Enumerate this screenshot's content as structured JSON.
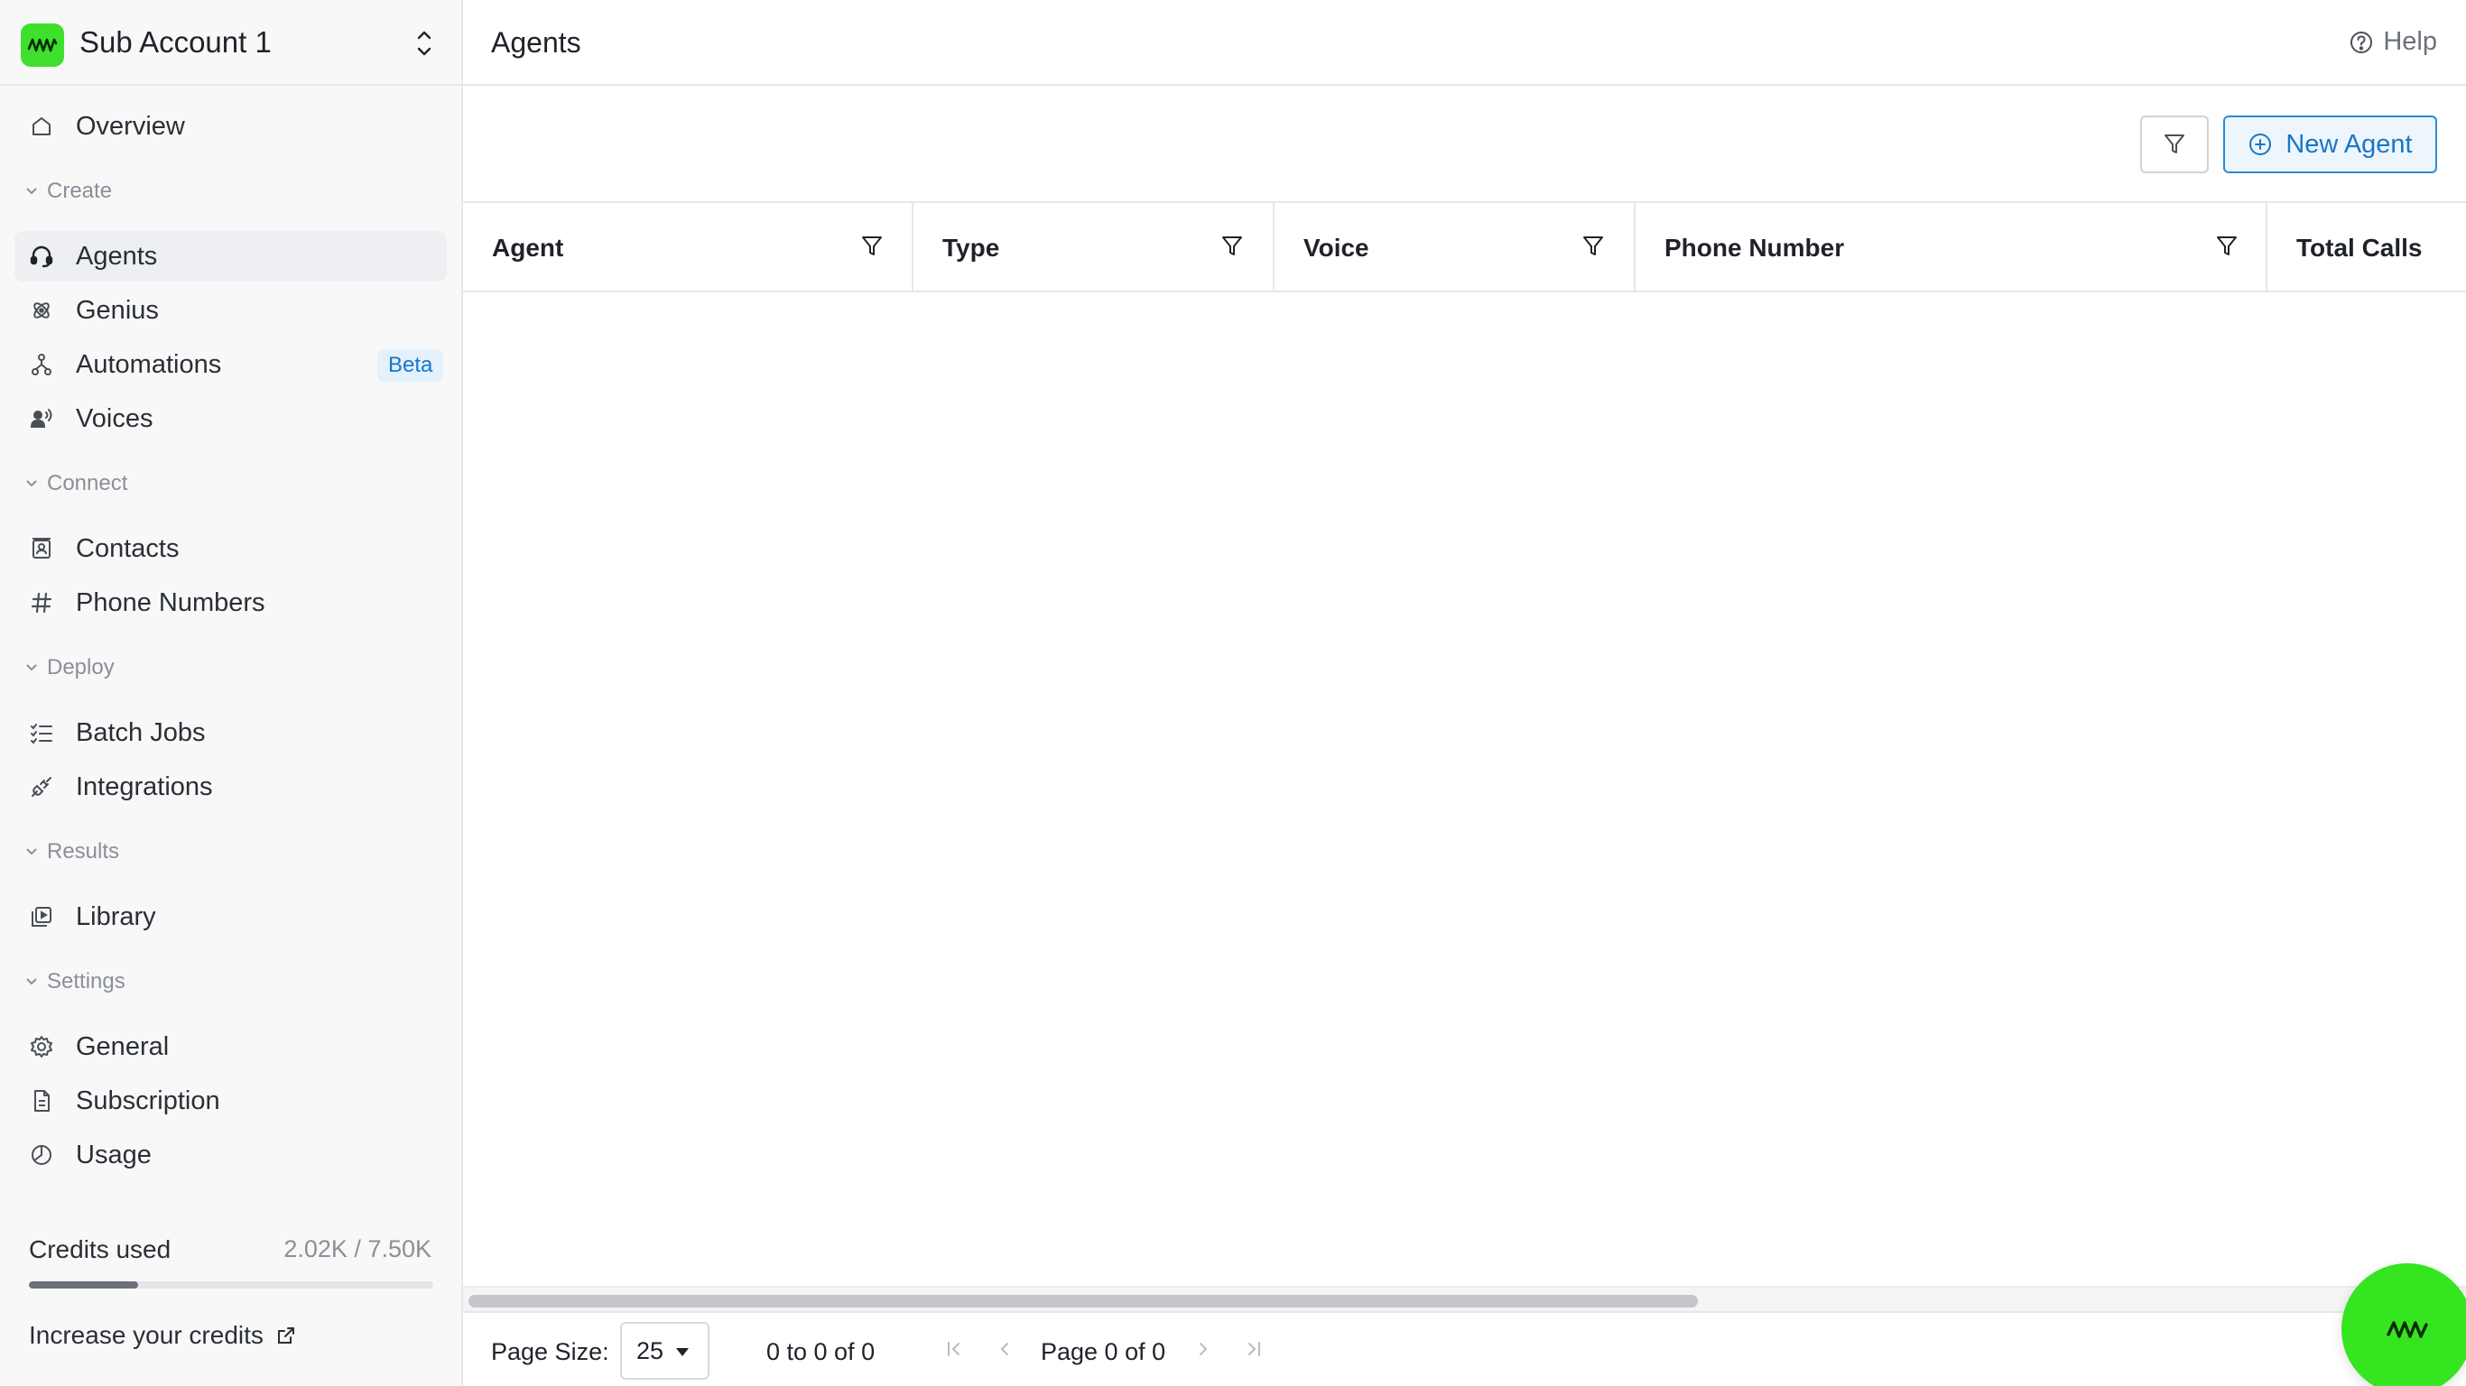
{
  "sidebar": {
    "account_name": "Sub Account 1",
    "overview_label": "Overview",
    "sections": {
      "create": "Create",
      "connect": "Connect",
      "deploy": "Deploy",
      "results": "Results",
      "settings": "Settings"
    },
    "items": {
      "agents": "Agents",
      "genius": "Genius",
      "automations": "Automations",
      "automations_badge": "Beta",
      "voices": "Voices",
      "contacts": "Contacts",
      "phone_numbers": "Phone Numbers",
      "batch_jobs": "Batch Jobs",
      "integrations": "Integrations",
      "library": "Library",
      "general": "General",
      "subscription": "Subscription",
      "usage": "Usage"
    },
    "active_item": "agents",
    "credits": {
      "label": "Credits used",
      "value": "2.02K / 7.50K",
      "used_fraction": 0.27,
      "increase_label": "Increase your credits"
    }
  },
  "header": {
    "title": "Agents",
    "help_label": "Help"
  },
  "toolbar": {
    "new_agent_label": "New Agent"
  },
  "table": {
    "columns": [
      "Agent",
      "Type",
      "Voice",
      "Phone Number",
      "Total Calls"
    ],
    "rows": []
  },
  "pagination": {
    "page_size_label": "Page Size:",
    "page_size": "25",
    "range_text": "0 to 0 of 0",
    "page_text": "Page 0 of 0"
  },
  "colors": {
    "brand_green": "#3ee02d",
    "accent_blue": "#1976c7",
    "badge_bg": "#e3f1fc"
  },
  "icons": {
    "logo": "waveform-logo-icon",
    "help": "question-circle-icon",
    "new_agent": "plus-circle-icon",
    "filter": "funnel-icon"
  }
}
